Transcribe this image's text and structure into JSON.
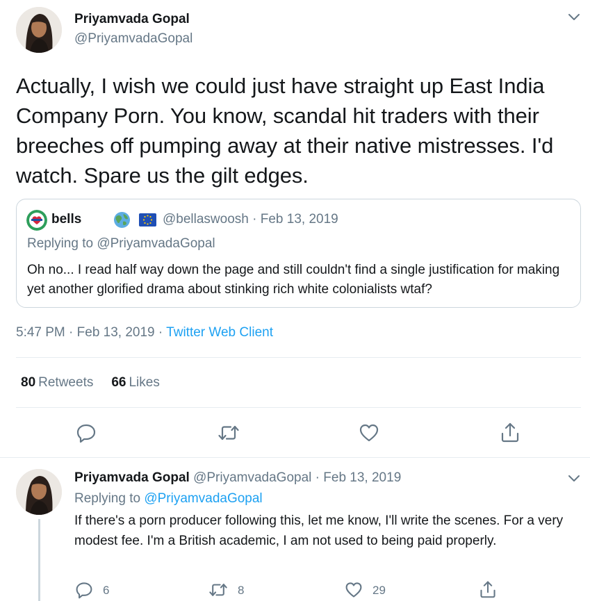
{
  "main_tweet": {
    "author_name": "Priyamvada Gopal",
    "author_handle": "@PriyamvadaGopal",
    "text": "Actually, I wish we could just have straight up East India Company Porn. You know, scandal hit traders with their breeches off pumping away at their native mistresses. I'd watch. Spare us the gilt edges.",
    "quoted": {
      "name": "bells",
      "handle": "@bellaswoosh",
      "date": "· Feb 13, 2019",
      "replying_to": "Replying to @PriyamvadaGopal",
      "text": "Oh no... I read half way down the page and still couldn't find a single justification for making yet another glorified drama about stinking rich white colonialists wtaf?"
    },
    "timestamp": "5:47 PM · Feb 13, 2019 · ",
    "client": "Twitter Web Client",
    "retweets_count": "80",
    "retweets_label": "Retweets",
    "likes_count": "66",
    "likes_label": "Likes"
  },
  "reply_tweet": {
    "author_name": "Priyamvada Gopal",
    "author_handle": "@PriyamvadaGopal",
    "date": "· Feb 13, 2019",
    "replying_label": "Replying to ",
    "replying_handle": "@PriyamvadaGopal",
    "text": "If there's a porn producer following this, let me know, I'll write the scenes. For a very modest fee. I'm a British academic, I am not used to being paid properly.",
    "reply_count": "6",
    "retweet_count": "8",
    "like_count": "29"
  },
  "icons": {
    "reply": "reply-icon",
    "retweet": "retweet-icon",
    "like": "heart-icon",
    "share": "share-icon",
    "caret": "chevron-down-icon"
  },
  "colors": {
    "text": "#14171a",
    "secondary": "#657786",
    "link": "#1da1f2",
    "border": "#e6ecf0"
  }
}
